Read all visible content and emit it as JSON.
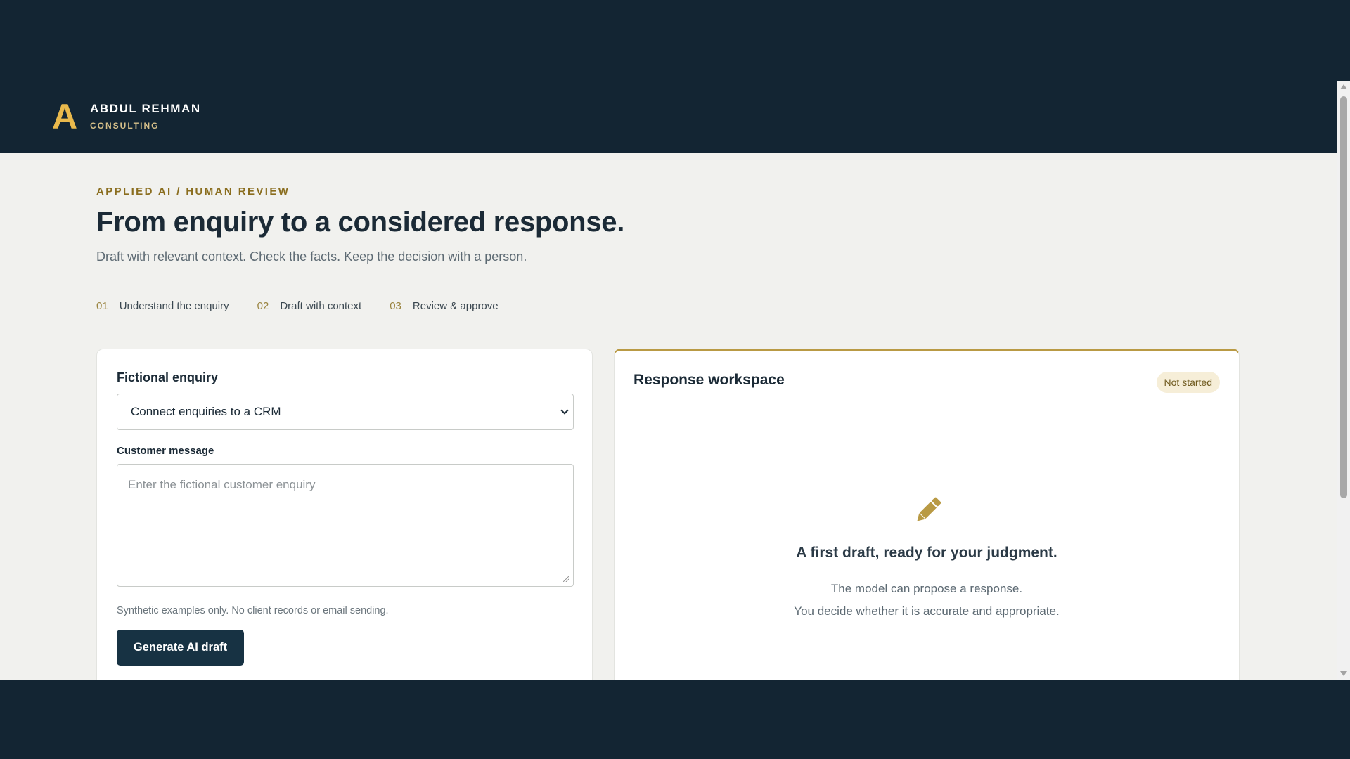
{
  "brand": {
    "mark": "A",
    "name": "ABDUL REHMAN",
    "sub": "CONSULTING",
    "accent_color": "#e9b94c"
  },
  "hero": {
    "eyebrow": "APPLIED AI / HUMAN REVIEW",
    "title": "From enquiry to a considered response.",
    "subtitle": "Draft with relevant context. Check the facts. Keep the decision with a person."
  },
  "steps": [
    {
      "num": "01",
      "label": "Understand the enquiry"
    },
    {
      "num": "02",
      "label": "Draft with context"
    },
    {
      "num": "03",
      "label": "Review & approve"
    }
  ],
  "enquiry_card": {
    "heading": "Fictional enquiry",
    "select_value": "Connect enquiries to a CRM",
    "message_label": "Customer message",
    "message_placeholder": "Enter the fictional customer enquiry",
    "helper": "Synthetic examples only. No client records or email sending.",
    "button_label": "Generate AI draft",
    "button_color": "#173243"
  },
  "workspace_card": {
    "heading": "Response workspace",
    "status": "Not started",
    "icon": "pencil-icon",
    "empty_title": "A first draft, ready for your judgment.",
    "empty_line_1": "The model can propose a response.",
    "empty_line_2": "You decide whether it is accurate and appropriate.",
    "accent_color": "#b99a44"
  }
}
